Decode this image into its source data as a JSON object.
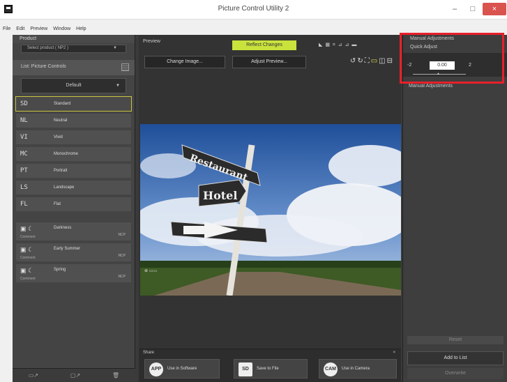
{
  "window": {
    "title": "Picture Control Utility 2",
    "min": "–",
    "max": "□",
    "close": "×"
  },
  "menu": [
    "File",
    "Edit",
    "Preview",
    "Window",
    "Help"
  ],
  "left": {
    "product_label": "Product",
    "product_select": "Select product ( NP2 )",
    "list_label": "List: Picture Controls",
    "default_select": "Default",
    "items": [
      {
        "code": "SD",
        "label": "Standard"
      },
      {
        "code": "NL",
        "label": "Neutral"
      },
      {
        "code": "VI",
        "label": "Vivid"
      },
      {
        "code": "MC",
        "label": "Monochrome"
      },
      {
        "code": "PT",
        "label": "Portrait"
      },
      {
        "code": "LS",
        "label": "Landscape"
      },
      {
        "code": "FL",
        "label": "Flat"
      }
    ],
    "custom": [
      {
        "label": "Darkness",
        "sub": "Comment",
        "tag": "NCP"
      },
      {
        "label": "Early Summer",
        "sub": "Comment",
        "tag": "NCP"
      },
      {
        "label": "Spring",
        "sub": "Comment",
        "tag": "NCP"
      }
    ]
  },
  "center": {
    "preview_label": "Preview",
    "reflect_label": "Reflect Changes",
    "change_image": "Change Image...",
    "adjust_preview": "Adjust Preview...",
    "signs": [
      "Restaurant",
      "Hotel"
    ],
    "share_label": "Share",
    "share_close": "×",
    "share_buttons": [
      {
        "icon": "APP",
        "label": "Use in Software"
      },
      {
        "icon": "SD",
        "label": "Save to File"
      },
      {
        "icon": "CAM",
        "label": "Use in Camera"
      }
    ]
  },
  "right": {
    "head": "Manual Adjustments",
    "quick_adjust": "Quick Adjust",
    "qa_min": "-2",
    "qa_value": "0.00",
    "qa_max": "2",
    "manual_sub": "Manual Adjustments",
    "reset": "Reset",
    "add_to_list": "Add to List",
    "overwrite": "Overwrite"
  },
  "colors": {
    "accent": "#c9e33c",
    "highlight": "#e8202a",
    "selected_border": "#c9c640"
  }
}
